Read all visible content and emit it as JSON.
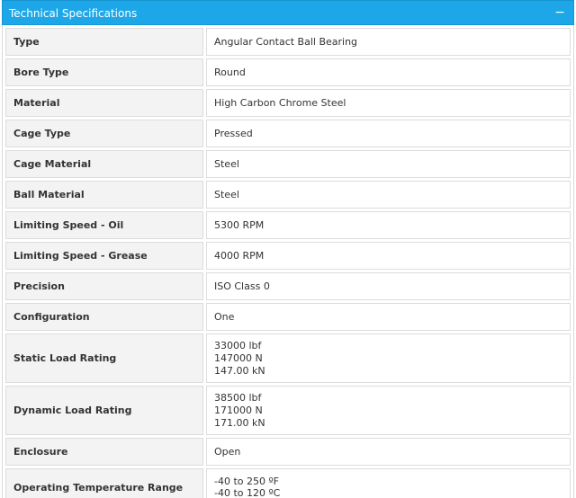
{
  "panel": {
    "title": "Technical Specifications",
    "collapse_symbol": "−"
  },
  "rows": [
    {
      "label": "Type",
      "value": [
        "Angular Contact Ball Bearing"
      ]
    },
    {
      "label": "Bore Type",
      "value": [
        "Round"
      ]
    },
    {
      "label": "Material",
      "value": [
        "High Carbon Chrome Steel"
      ]
    },
    {
      "label": "Cage Type",
      "value": [
        "Pressed"
      ]
    },
    {
      "label": "Cage Material",
      "value": [
        "Steel"
      ]
    },
    {
      "label": "Ball Material",
      "value": [
        "Steel"
      ]
    },
    {
      "label": "Limiting Speed - Oil",
      "value": [
        "5300 RPM"
      ]
    },
    {
      "label": "Limiting Speed - Grease",
      "value": [
        "4000 RPM"
      ]
    },
    {
      "label": "Precision",
      "value": [
        "ISO Class 0"
      ]
    },
    {
      "label": "Configuration",
      "value": [
        "One"
      ]
    },
    {
      "label": "Static Load Rating",
      "value": [
        "33000 lbf",
        "147000 N",
        "147.00 kN"
      ]
    },
    {
      "label": "Dynamic Load Rating",
      "value": [
        "38500 lbf",
        "171000 N",
        "171.00 kN"
      ]
    },
    {
      "label": "Enclosure",
      "value": [
        "Open"
      ]
    },
    {
      "label": "Operating Temperature Range",
      "value": [
        "-40 to 250 ºF",
        "-40 to 120 ºC"
      ]
    }
  ]
}
